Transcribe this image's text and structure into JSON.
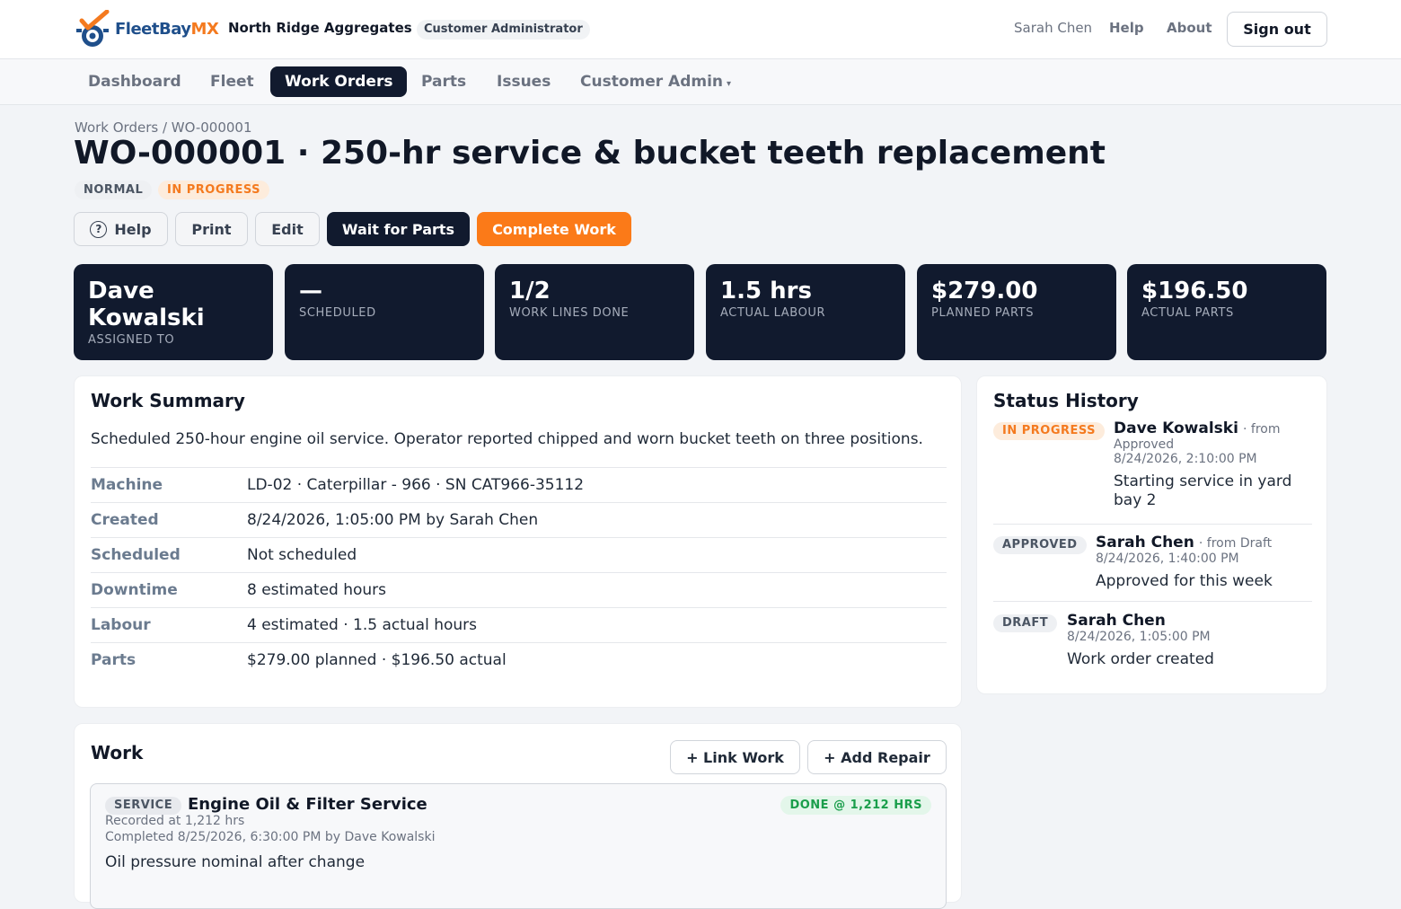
{
  "header": {
    "logo_fleet": "FleetBay",
    "logo_mx": "MX",
    "org_name": "North Ridge Aggregates",
    "role": "Customer Administrator",
    "user": "Sarah Chen",
    "help": "Help",
    "about": "About",
    "signout": "Sign out"
  },
  "nav": {
    "items": [
      "Dashboard",
      "Fleet",
      "Work Orders",
      "Parts",
      "Issues",
      "Customer Admin"
    ],
    "active": "Work Orders",
    "caret": "▾"
  },
  "breadcrumb": "Work Orders / WO-000001",
  "title": "WO-000001 · 250-hr service & bucket teeth replacement",
  "badges": {
    "priority": "NORMAL",
    "status": "IN PROGRESS"
  },
  "actions": {
    "help": "Help",
    "help_glyph": "?",
    "print": "Print",
    "edit": "Edit",
    "wait": "Wait for Parts",
    "complete": "Complete Work"
  },
  "stats": [
    {
      "value": "Dave Kowalski",
      "label": "ASSIGNED TO"
    },
    {
      "value": "—",
      "label": "SCHEDULED"
    },
    {
      "value": "1/2",
      "label": "WORK LINES DONE"
    },
    {
      "value": "1.5 hrs",
      "label": "ACTUAL LABOUR"
    },
    {
      "value": "$279.00",
      "label": "PLANNED PARTS"
    },
    {
      "value": "$196.50",
      "label": "ACTUAL PARTS"
    }
  ],
  "summary": {
    "title": "Work Summary",
    "description": "Scheduled 250-hour engine oil service. Operator reported chipped and worn bucket teeth on three positions.",
    "rows": [
      {
        "key": "Machine",
        "value": "LD-02 · Caterpillar - 966 · SN CAT966-35112"
      },
      {
        "key": "Created",
        "value": "8/24/2026, 1:05:00 PM by Sarah Chen"
      },
      {
        "key": "Scheduled",
        "value": "Not scheduled"
      },
      {
        "key": "Downtime",
        "value": "8 estimated hours"
      },
      {
        "key": "Labour",
        "value": "4 estimated · 1.5 actual hours"
      },
      {
        "key": "Parts",
        "value": "$279.00 planned · $196.50 actual"
      }
    ]
  },
  "history": {
    "title": "Status History",
    "entries": [
      {
        "status": "IN PROGRESS",
        "who": "Dave Kowalski",
        "from": "· from",
        "from2": "Approved",
        "time": "8/24/2026, 2:10:00 PM",
        "note": "Starting service in yard bay 2"
      },
      {
        "status": "APPROVED",
        "who": "Sarah Chen",
        "from": "· from Draft",
        "time": "8/24/2026, 1:40:00 PM",
        "note": "Approved for this week"
      },
      {
        "status": "DRAFT",
        "who": "Sarah Chen",
        "time": "8/24/2026, 1:05:00 PM",
        "note": "Work order created"
      }
    ]
  },
  "work": {
    "title": "Work",
    "link": "+ Link Work",
    "add": "+ Add Repair",
    "line": {
      "type": "SERVICE",
      "title": "Engine Oil & Filter Service",
      "done": "DONE @ 1,212 HRS",
      "recorded": "Recorded at 1,212 hrs",
      "completed": "Completed 8/25/2026, 6:30:00 PM by Dave Kowalski",
      "note": "Oil pressure nominal after change"
    }
  },
  "colors": {
    "navy": "#111a2e",
    "orange": "#fb7a18",
    "green": "#1a9e4b"
  }
}
